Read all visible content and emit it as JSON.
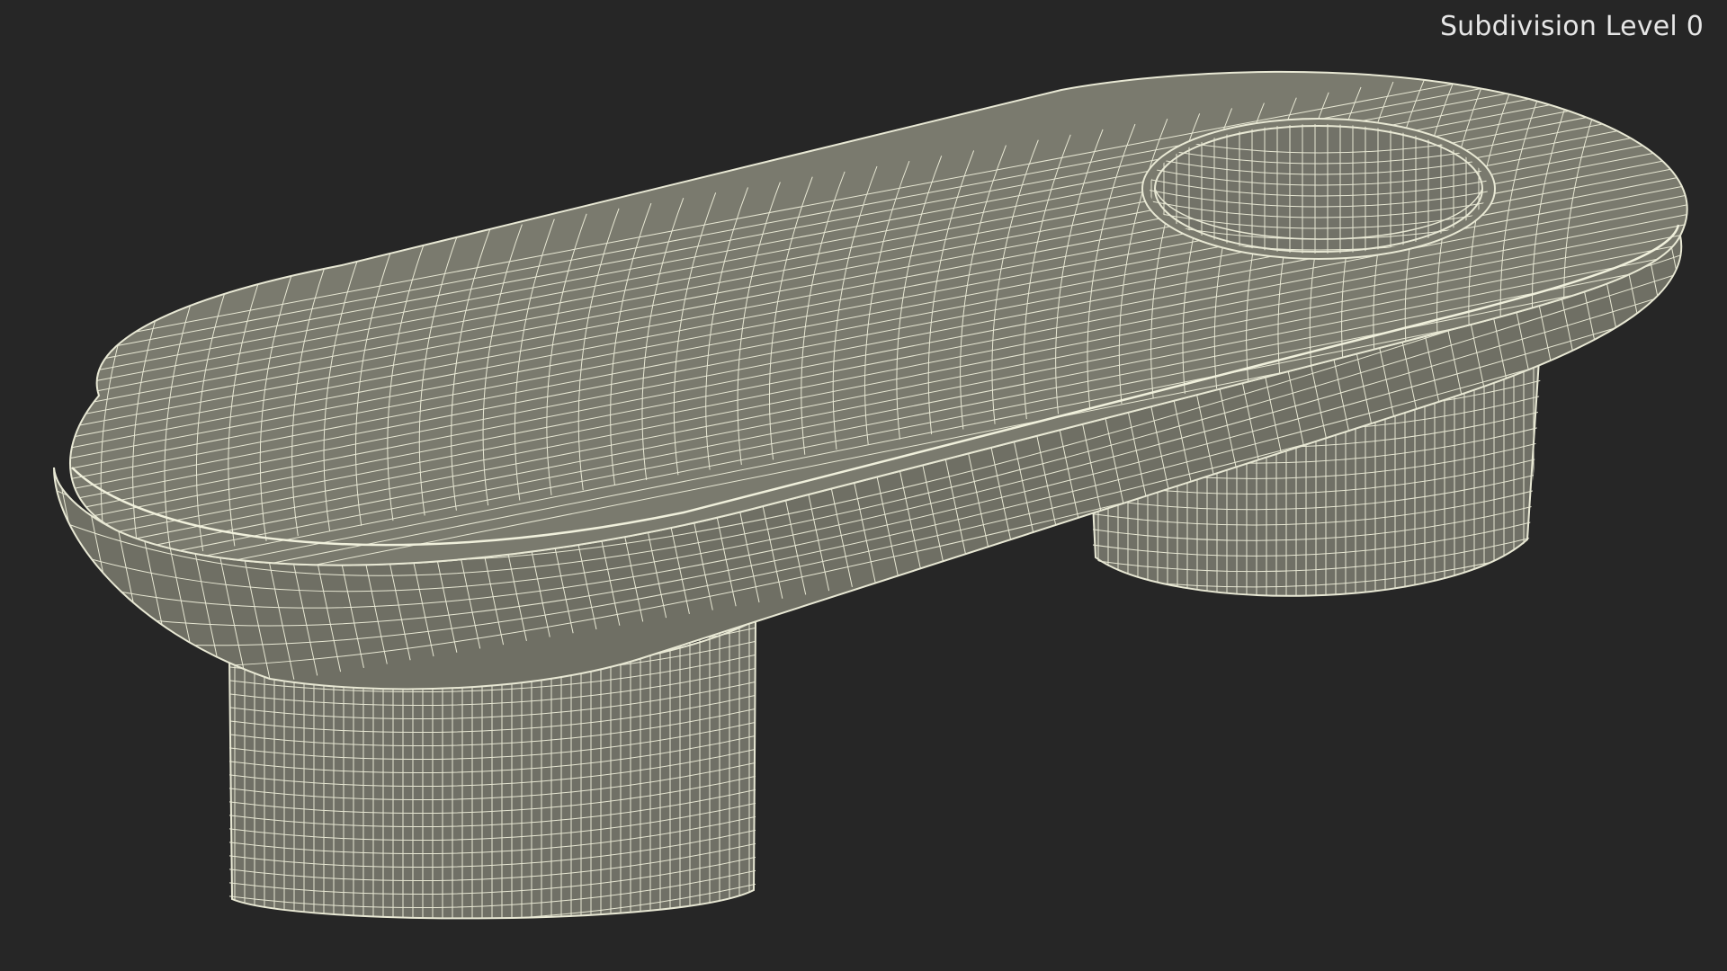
{
  "viewport": {
    "subdivision_label": "Subdivision Level 0",
    "background_color": "#262626"
  },
  "model": {
    "surface_color": "#767669",
    "wire_color": "#e8e8d4",
    "description_icon": "wireframe-bench-model"
  }
}
